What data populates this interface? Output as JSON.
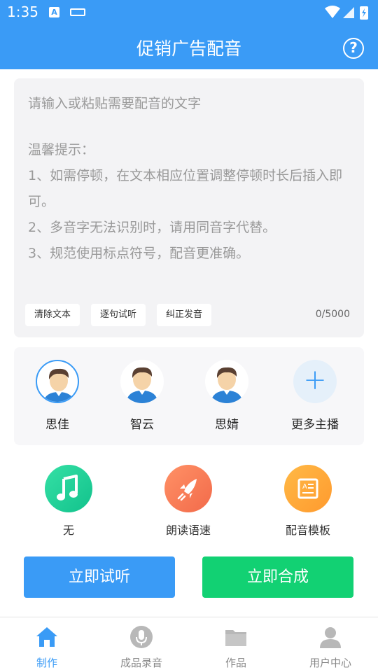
{
  "status_bar": {
    "time": "1:35",
    "icons": [
      "a-notification-icon",
      "keyboard-icon",
      "wifi-icon",
      "signal-icon",
      "battery-icon"
    ]
  },
  "header": {
    "title": "促销广告配音",
    "help_icon": "question-circle-icon"
  },
  "text_input": {
    "placeholder": "请输入或粘贴需要配音的文字",
    "tips_title": "温馨提示：",
    "tips": [
      "1、如需停顿，在文本相应位置调整停顿时长后插入即可。",
      "2、多音字无法识别时，请用同音字代替。",
      "3、规范使用标点符号，配音更准确。"
    ],
    "buttons": {
      "clear": "清除文本",
      "sentence_preview": "逐句试听",
      "correct_pronunciation": "纠正发音"
    },
    "counter": "0/5000"
  },
  "voices": [
    {
      "name": "思佳",
      "selected": true
    },
    {
      "name": "智云",
      "selected": false
    },
    {
      "name": "思婧",
      "selected": false
    },
    {
      "name": "更多主播",
      "icon": "plus-icon"
    }
  ],
  "features": [
    {
      "label": "无",
      "icon": "music-note-icon"
    },
    {
      "label": "朗读语速",
      "icon": "rocket-icon"
    },
    {
      "label": "配音模板",
      "icon": "template-doc-icon"
    }
  ],
  "actions": {
    "listen": "立即试听",
    "synthesize": "立即合成"
  },
  "nav": [
    {
      "label": "制作",
      "icon": "home-icon",
      "active": true
    },
    {
      "label": "成品录音",
      "icon": "microphone-icon",
      "active": false
    },
    {
      "label": "作品",
      "icon": "folder-icon",
      "active": false
    },
    {
      "label": "用户中心",
      "icon": "user-icon",
      "active": false
    }
  ],
  "colors": {
    "primary": "#3A9BF6",
    "green": "#12D173",
    "inactive_nav": "#B8B8B8"
  }
}
